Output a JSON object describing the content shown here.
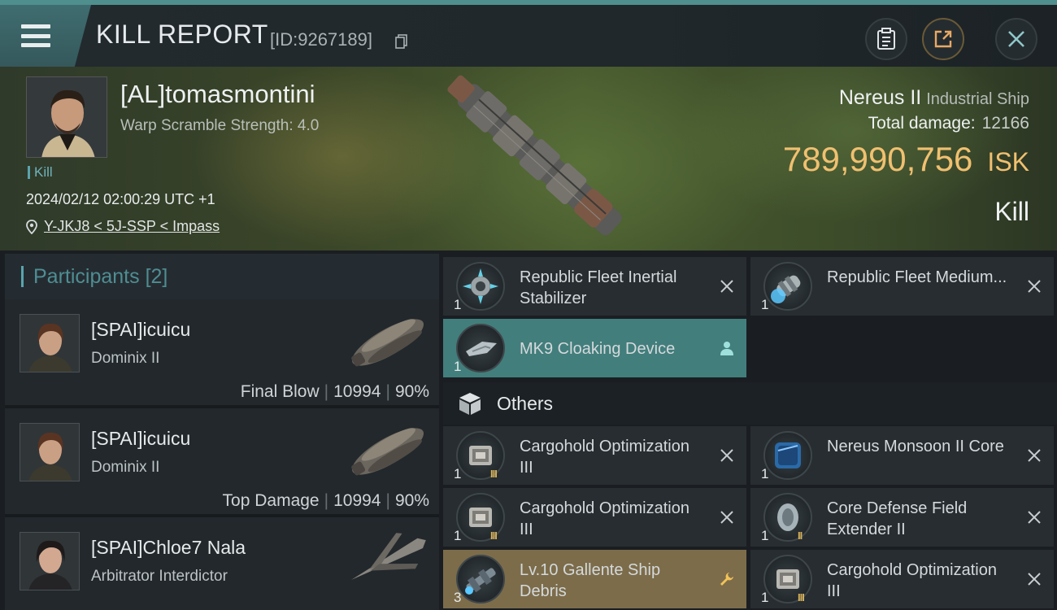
{
  "header": {
    "title": "KILL REPORT",
    "report_id": "[ID:9267189]",
    "icons": [
      "menu-icon",
      "copy-icon",
      "clipboard-icon",
      "share-icon",
      "close-icon"
    ]
  },
  "victim": {
    "name": "[AL]tomasmontini",
    "warp_scramble": "Warp Scramble Strength: 4.0",
    "kill_tag": "Kill",
    "datetime": "2024/02/12 02:00:29 UTC +1",
    "location": "Y-JKJ8 < 5J-SSP < Impass",
    "ship_name": "Nereus II",
    "ship_class": "Industrial Ship",
    "total_damage_label": "Total damage:",
    "total_damage": "12166",
    "isk_value": "789,990,756",
    "isk_unit": "ISK",
    "result": "Kill"
  },
  "participants": {
    "title": "Participants",
    "count": "[2]",
    "items": [
      {
        "name": "[SPAI]icuicu",
        "ship": "Dominix II",
        "role": "Final Blow",
        "damage": "10994",
        "percent": "90%"
      },
      {
        "name": "[SPAI]icuicu",
        "ship": "Dominix II",
        "role": "Top Damage",
        "damage": "10994",
        "percent": "90%"
      },
      {
        "name": "[SPAI]Chloe7 Nala",
        "ship": "Arbitrator Interdictor",
        "badge": "i"
      }
    ]
  },
  "items": {
    "modules": [
      {
        "name": "Republic Fleet Inertial Stabilizer",
        "qty": "1",
        "state": "destroyed"
      },
      {
        "name": "Republic Fleet Medium...",
        "qty": "1",
        "state": "destroyed"
      },
      {
        "name": "MK9 Cloaking Device",
        "qty": "1",
        "state": "dropped-player"
      }
    ],
    "others_label": "Others",
    "others": [
      {
        "name": "Cargohold Optimization III",
        "qty": "1",
        "tier": "III",
        "state": "destroyed"
      },
      {
        "name": "Nereus Monsoon II Core",
        "qty": "1",
        "state": "destroyed"
      },
      {
        "name": "Cargohold Optimization III",
        "qty": "1",
        "tier": "III",
        "state": "destroyed"
      },
      {
        "name": "Core Defense Field Extender II",
        "qty": "1",
        "tier": "II",
        "state": "destroyed"
      },
      {
        "name": "Lv.10 Gallente Ship Debris",
        "qty": "3",
        "state": "dropped-wrench"
      },
      {
        "name": "Cargohold Optimization III",
        "qty": "1",
        "tier": "III",
        "state": "destroyed"
      }
    ]
  },
  "colors": {
    "accent_teal": "#4f8f8e",
    "isk_gold": "#f0c070",
    "highlight_teal": "#427e7c",
    "highlight_gold": "#7c6c4a"
  }
}
